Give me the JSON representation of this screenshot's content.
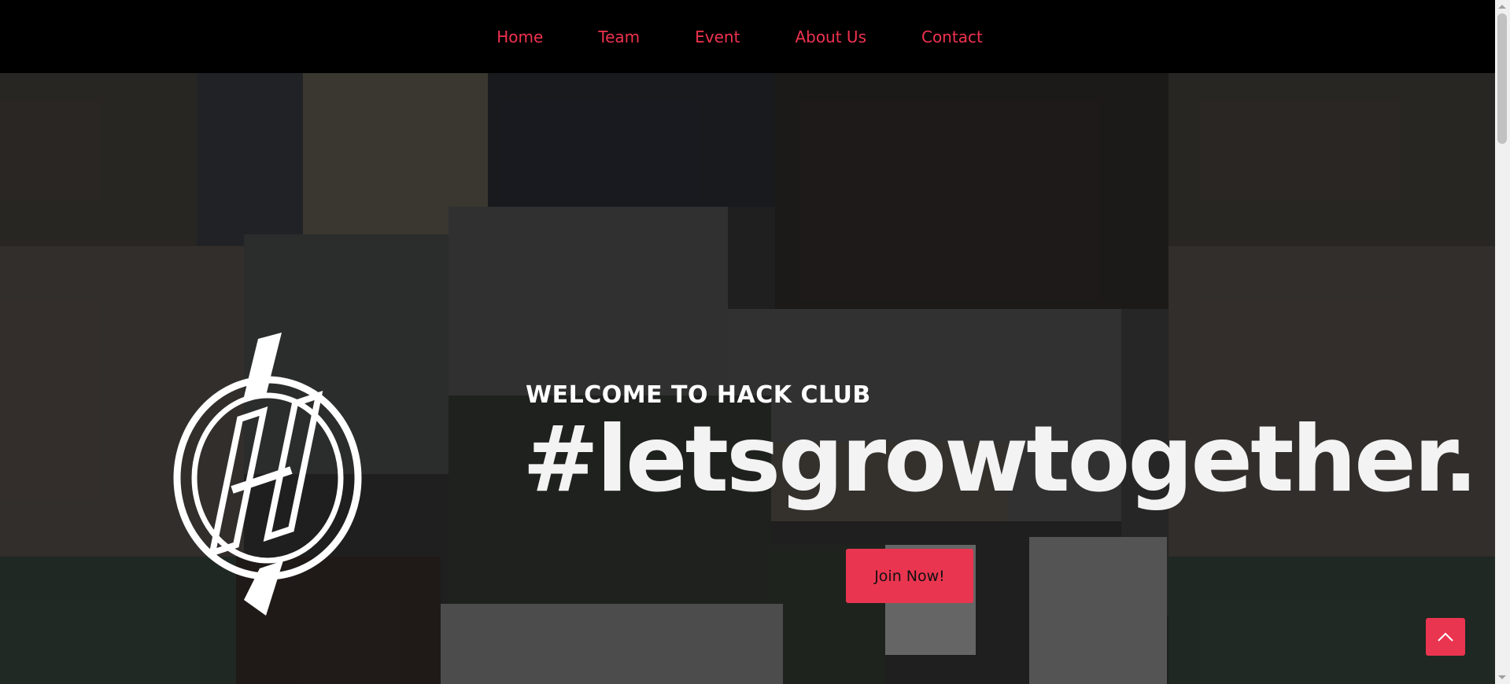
{
  "nav": {
    "items": [
      {
        "label": "Home"
      },
      {
        "label": "Team"
      },
      {
        "label": "Event"
      },
      {
        "label": "About Us"
      },
      {
        "label": "Contact"
      }
    ],
    "link_color": "#f0324f"
  },
  "hero": {
    "welcome": "WELCOME TO HACK CLUB",
    "tagline": "#letsgrowtogether.",
    "join_button": "Join Now!",
    "background": "photo collage of club members (darkened)",
    "accent_color": "#ea3550"
  },
  "scroll_top_icon": "chevron-up-icon",
  "logo_icon": "hack-club-logo-icon"
}
